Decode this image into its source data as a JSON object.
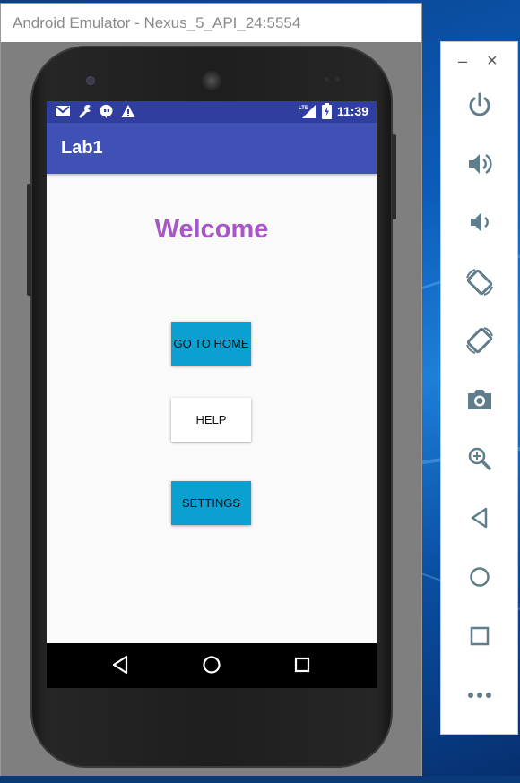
{
  "window": {
    "title": "Android Emulator - Nexus_5_API_24:5554"
  },
  "status_bar": {
    "time": "11:39",
    "left_icons": [
      "gmail-icon",
      "wrench-icon",
      "hangouts-icon",
      "warning-icon"
    ],
    "right_icons": [
      "lte-signal-icon",
      "battery-charging-icon"
    ],
    "lte_label": "LTE"
  },
  "app": {
    "title": "Lab1",
    "welcome_text": "Welcome",
    "buttons": {
      "home": "GO TO HOME",
      "help": "HELP",
      "settings": "SETTINGS"
    }
  },
  "nav_bar": {
    "icons": [
      "back-icon",
      "home-icon",
      "recents-icon"
    ]
  },
  "side_panel": {
    "minimize": "–",
    "close": "×",
    "controls": [
      "power-icon",
      "volume-up-icon",
      "volume-down-icon",
      "rotate-left-icon",
      "rotate-right-icon",
      "camera-icon",
      "zoom-icon",
      "back-icon",
      "home-icon",
      "overview-icon",
      "more-icon"
    ]
  },
  "colors": {
    "status_bar": "#303f9f",
    "action_bar": "#3f51b5",
    "welcome": "#a857c7",
    "button_blue": "#0aa0d0",
    "side_icon": "#607d8b"
  }
}
